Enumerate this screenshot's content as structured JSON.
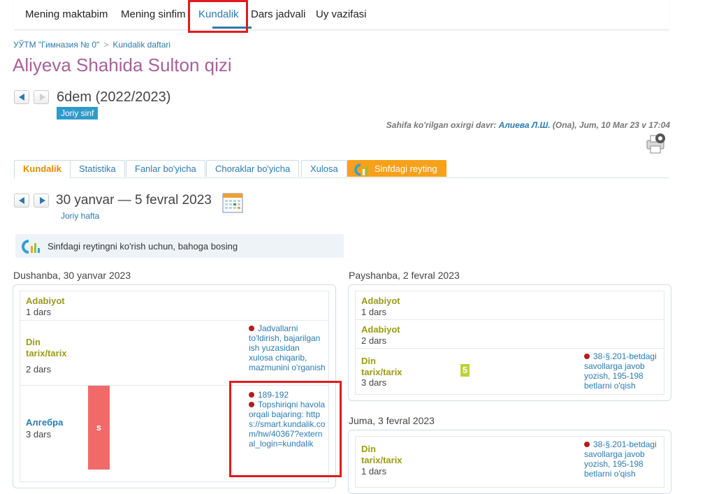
{
  "nav": {
    "items": [
      "Mening maktabim",
      "Mening sinfim",
      "Kundalik",
      "Dars jadvali",
      "Uy vazifasi"
    ]
  },
  "breadcrumb": {
    "school": "УЎТМ \"Гимназия № 0\"",
    "sep": ">",
    "page": "Kundalik daftari"
  },
  "student_name": "Aliyeva Shahida Sulton qizi",
  "class": {
    "name": "6dem (2022/2023)",
    "badge": "Joriy sinf"
  },
  "last_view": {
    "prefix": "Sahifa ko'rilgan oxirgi davr:",
    "who": "Алиева Л.Ш.",
    "rest": "(Ona), Jum, 10 Mar 23 v 17:04"
  },
  "tabs": [
    "Kundalik",
    "Statistika",
    "Fanlar bo'yicha",
    "Choraklar bo'yicha",
    "Xulosa",
    "Sinfdagi reyting"
  ],
  "week": {
    "range": "30 yanvar — 5 fevral 2023",
    "current_link": "Joriy hafta"
  },
  "info": "Sinfdagi reytingni ko'rish uchun, bahoga bosing",
  "days": {
    "monday": {
      "title": "Dushanba, 30 yanvar 2023",
      "lessons": [
        {
          "subject": "Adabiyot",
          "count": "1 dars"
        },
        {
          "subject": "Din tarix/tarix",
          "count": "2 dars",
          "hw": [
            "Jadvallarni to'ldirish, bajarilgan ish yuzasidan xulosa chiqarib, mazmunini o'rganish"
          ]
        },
        {
          "subject": "Алгебра",
          "count": "3 dars",
          "mark": "s",
          "hw": [
            "189-192",
            "Topshiriqni havola orqali bajaring: https://smart.kundalik.com/hw/40367?external_login=kundalik"
          ]
        }
      ]
    },
    "thursday": {
      "title": "Payshanba, 2 fevral 2023",
      "lessons": [
        {
          "subject": "Adabiyot",
          "count": "1 dars"
        },
        {
          "subject": "Adabiyot",
          "count": "2 dars"
        },
        {
          "subject": "Din tarix/tarix",
          "count": "3 dars",
          "mark": "5",
          "hw": [
            "38-§.201-betdagi savollarga javob yozish, 195-198 betlarni o'qish"
          ]
        }
      ]
    },
    "friday": {
      "title": "Juma, 3 fevral 2023",
      "lessons": [
        {
          "subject": "Din tarix/tarix",
          "count": "1 dars",
          "hw": [
            "38-§.201-betdagi savollarga javob yozish, 195-198 betlarni o'qish"
          ]
        }
      ]
    }
  },
  "colors": {
    "accent": "#2a7ab0",
    "highlight": "#e01b1b",
    "student": "#a8609a",
    "subject": "#9a9a18",
    "orange_tab": "#f7a11a"
  }
}
